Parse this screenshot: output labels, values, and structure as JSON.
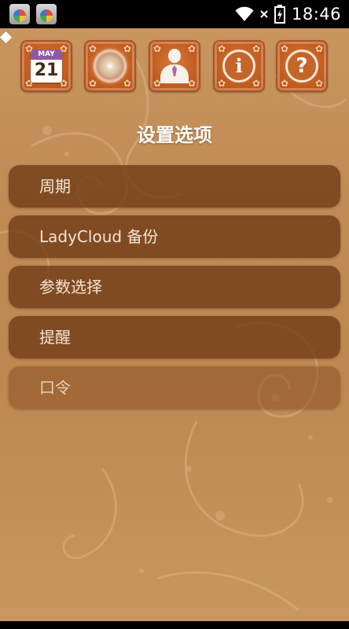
{
  "status_bar": {
    "time": "18:46",
    "notification_icons": [
      "app-notification-icon",
      "app-notification-icon"
    ],
    "system_icons": [
      "wifi-icon",
      "no-signal-icon",
      "battery-icon"
    ]
  },
  "toolbar": {
    "calendar": {
      "month": "MAY",
      "day": "21"
    },
    "buttons": [
      "calendar-icon",
      "clock-icon",
      "profile-icon",
      "info-icon",
      "help-icon"
    ]
  },
  "title": "设置选项",
  "menu": {
    "items": [
      {
        "label": "周期"
      },
      {
        "label": "LadyCloud 备份"
      },
      {
        "label": "参数选择"
      },
      {
        "label": "提醒"
      },
      {
        "label": "口令"
      }
    ]
  },
  "colors": {
    "background": "#c3905a",
    "menu_item": "#6e3a14",
    "toolbar_button": "#c25e23",
    "title_text": "#ffffff"
  }
}
